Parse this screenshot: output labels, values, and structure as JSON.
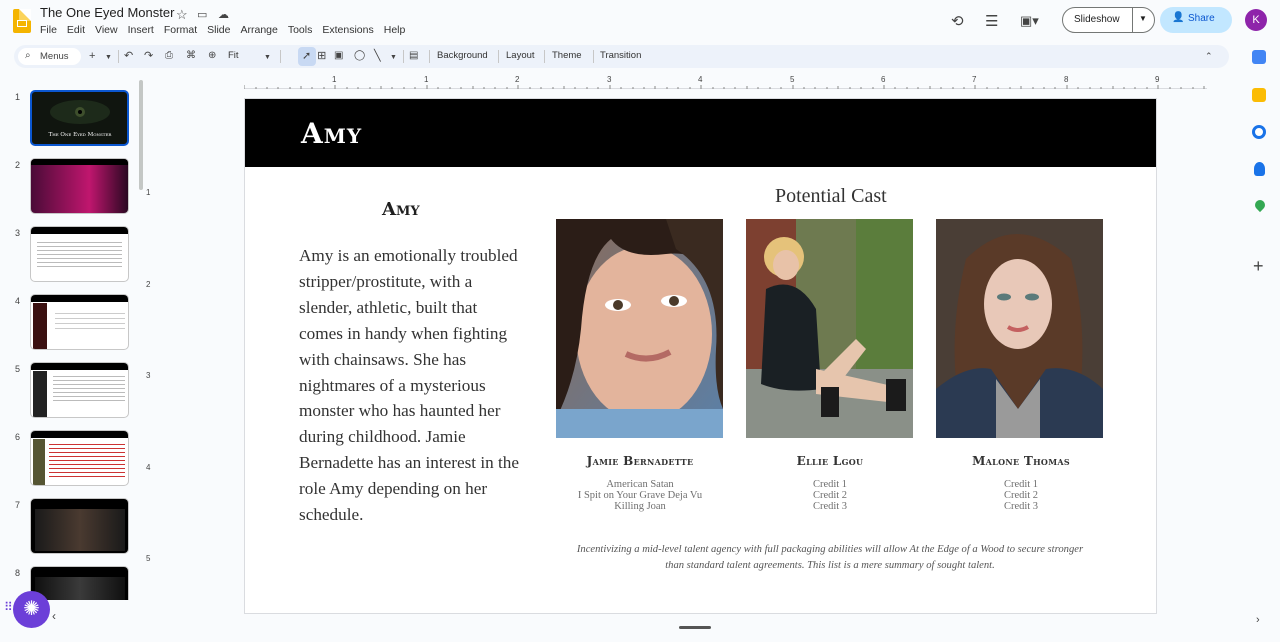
{
  "app": {
    "doc_title": "The One Eyed Monster",
    "menu": [
      "File",
      "Edit",
      "View",
      "Insert",
      "Format",
      "Slide",
      "Arrange",
      "Tools",
      "Extensions",
      "Help"
    ],
    "slideshow_label": "Slideshow",
    "share_label": "Share",
    "avatar_letter": "K"
  },
  "toolbar": {
    "menus_label": "Menus",
    "zoom_label": "Fit",
    "background_label": "Background",
    "layout_label": "Layout",
    "theme_label": "Theme",
    "transition_label": "Transition"
  },
  "ruler": {
    "h": [
      "1",
      "1",
      "2",
      "3",
      "4",
      "5",
      "6",
      "7",
      "8",
      "9"
    ],
    "v": [
      "1",
      "2",
      "3",
      "4",
      "5"
    ]
  },
  "filmstrip": {
    "numbers": [
      "1",
      "2",
      "3",
      "4",
      "5",
      "6",
      "7",
      "8"
    ],
    "thumb1_title": "The One Eyed Monster"
  },
  "slide": {
    "banner_title": "Amy",
    "character_name": "Amy",
    "bio": "Amy is an emotionally troubled stripper/prostitute, with a slender, athletic, built that comes in handy when fighting with chainsaws. She has nightmares of a mysterious monster who has haunted her during childhood. Jamie Bernadette has an interest in the role Amy depending on her schedule.",
    "potential_cast_title": "Potential Cast",
    "cast": [
      {
        "name": "Jamie Bernadette",
        "credits": [
          "American Satan",
          "I Spit on Your Grave Deja Vu",
          "Killing Joan"
        ]
      },
      {
        "name": "Ellie Lgou",
        "credits": [
          "Credit 1",
          "Credit 2",
          "Credit 3"
        ]
      },
      {
        "name": "Malone Thomas",
        "credits": [
          "Credit 1",
          "Credit 2",
          "Credit 3"
        ]
      }
    ],
    "footnote": "Incentivizing a mid-level talent agency with full packaging abilities will allow At the Edge of a Wood to secure stronger than standard talent agreements. This list is a mere summary of sought talent."
  },
  "colors": {
    "accent": "#0b57d0",
    "share_bg": "#c2e7ff",
    "banner": "#000000"
  }
}
